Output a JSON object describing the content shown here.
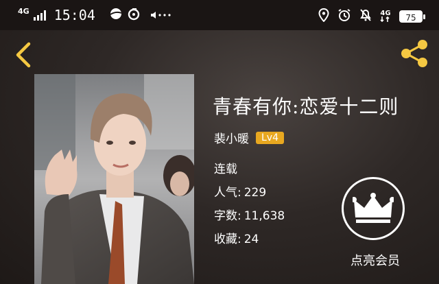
{
  "status_bar": {
    "network": "4G",
    "time": "15:04",
    "battery": "75",
    "data_network": "4G"
  },
  "header": {
    "back_icon": "chevron-left-icon",
    "share_icon": "share-icon",
    "accent_color": "#f5c842"
  },
  "book": {
    "title": "青春有你:恋爱十二则",
    "author": "裴小暖",
    "author_level": "Lv4",
    "status": "连载",
    "popularity_label": "人气",
    "popularity_value": "229",
    "word_count_label": "字数",
    "word_count_value": "11,638",
    "favorites_label": "收藏",
    "favorites_value": "24"
  },
  "vip": {
    "icon": "crown-icon",
    "label": "点亮会员"
  }
}
